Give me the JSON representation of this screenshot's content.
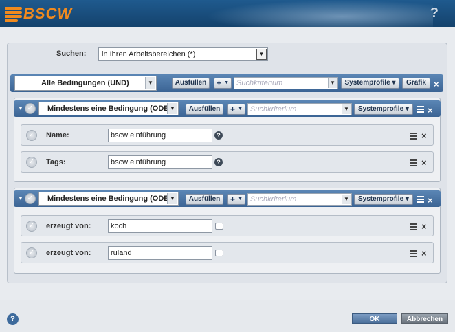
{
  "header": {
    "logo_text": "BSCW",
    "help": "?"
  },
  "search": {
    "label": "Suchen:",
    "value": "in Ihren Arbeitsbereichen (*)"
  },
  "main_group": {
    "condition": "Alle Bedingungen (UND)",
    "fill_label": "Ausfüllen",
    "criterion_placeholder": "Suchkriterium",
    "profiles_label": "Systemprofile",
    "graphic_label": "Grafik"
  },
  "groups": [
    {
      "condition": "Mindestens eine Bedingung (ODER)",
      "fill_label": "Ausfüllen",
      "criterion_placeholder": "Suchkriterium",
      "profiles_label": "Systemprofile",
      "rows": [
        {
          "label": "Name:",
          "value": "bscw einführung"
        },
        {
          "label": "Tags:",
          "value": "bscw einführung"
        }
      ]
    },
    {
      "condition": "Mindestens eine Bedingung (ODER)",
      "fill_label": "Ausfüllen",
      "criterion_placeholder": "Suchkriterium",
      "profiles_label": "Systemprofile",
      "rows": [
        {
          "label": "erzeugt von:",
          "value": "koch"
        },
        {
          "label": "erzeugt von:",
          "value": "ruland"
        }
      ]
    }
  ],
  "footer": {
    "ok_label": "OK",
    "cancel_label": "Abbrechen",
    "help": "?"
  }
}
